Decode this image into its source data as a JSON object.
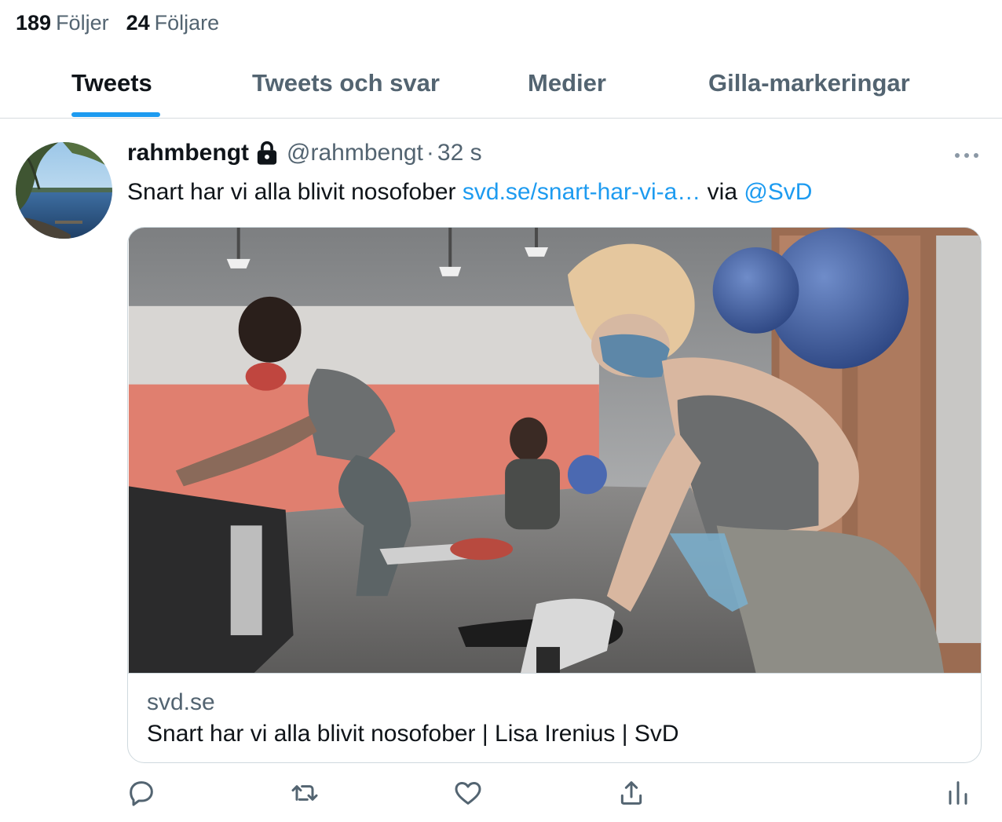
{
  "profile_stats": {
    "following_count": "189",
    "following_label": "Följer",
    "followers_count": "24",
    "followers_label": "Följare"
  },
  "tabs": [
    {
      "label": "Tweets",
      "active": true
    },
    {
      "label": "Tweets och svar",
      "active": false
    },
    {
      "label": "Medier",
      "active": false
    },
    {
      "label": "Gilla-markeringar",
      "active": false
    }
  ],
  "tweet": {
    "display_name": "rahmbengt",
    "protected_icon": "lock-icon",
    "handle": "@rahmbengt",
    "separator": "·",
    "time": "32 s",
    "text_prefix": "Snart har vi alla blivit nosofober ",
    "link_text": "svd.se/snart-har-vi-a…",
    "text_via": " via ",
    "mention": "@SvD",
    "card": {
      "domain": "svd.se",
      "title": "Snart har vi alla blivit nosofober | Lisa Irenius | SvD"
    },
    "actions": [
      "reply-icon",
      "retweet-icon",
      "like-icon",
      "share-icon",
      "analytics-icon"
    ]
  },
  "colors": {
    "accent": "#1d9bf0",
    "text_primary": "#0f1419",
    "text_secondary": "#536471",
    "border": "#cfd9de"
  }
}
